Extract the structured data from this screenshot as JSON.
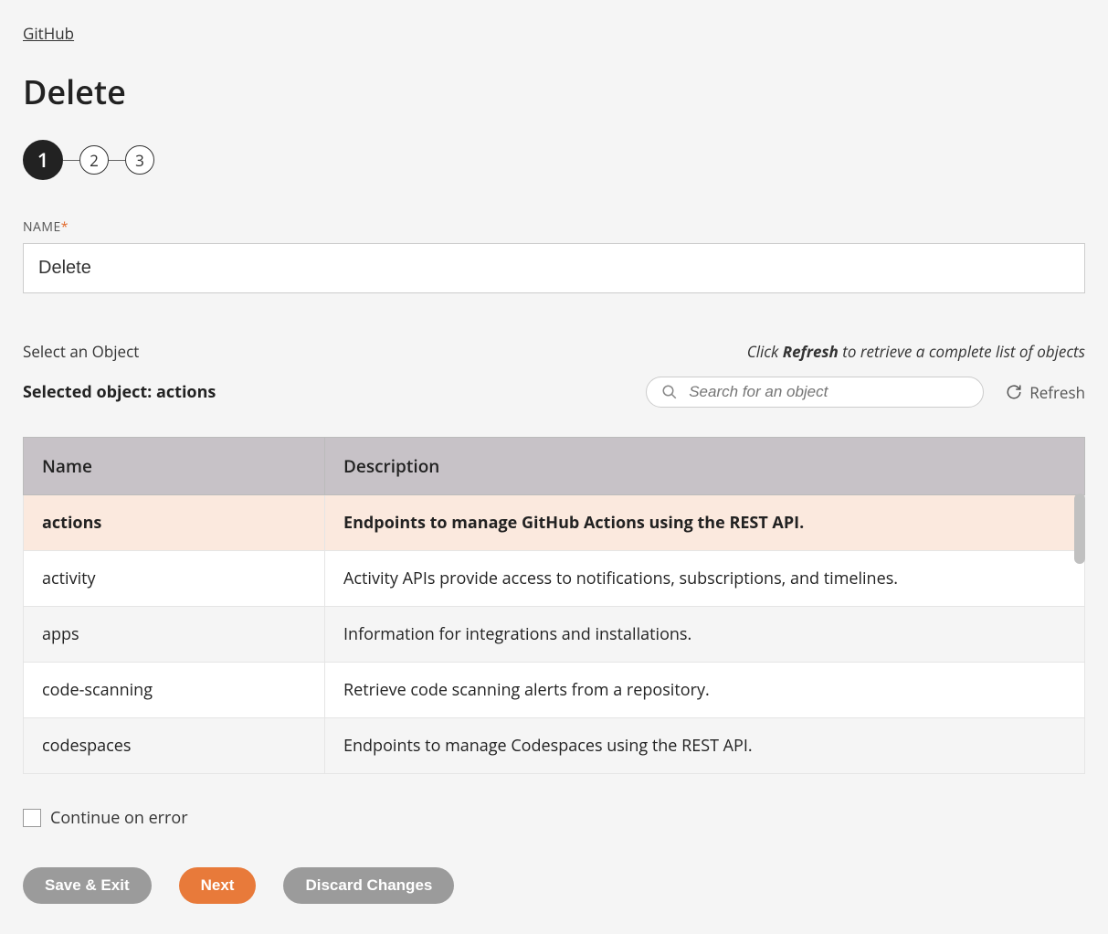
{
  "breadcrumb": {
    "parent": "GitHub"
  },
  "page": {
    "title": "Delete"
  },
  "stepper": {
    "steps": [
      "1",
      "2",
      "3"
    ],
    "active": 0
  },
  "form": {
    "name_label": "NAME",
    "required_mark": "*",
    "name_value": "Delete"
  },
  "object_section": {
    "select_label": "Select an Object",
    "hint_prefix": "Click ",
    "hint_bold": "Refresh",
    "hint_suffix": " to retrieve a complete list of objects",
    "selected_prefix": "Selected object: ",
    "selected_value": "actions",
    "search_placeholder": "Search for an object",
    "refresh_label": "Refresh"
  },
  "table": {
    "columns": {
      "name": "Name",
      "description": "Description"
    },
    "rows": [
      {
        "name": "actions",
        "description": "Endpoints to manage GitHub Actions using the REST API.",
        "selected": true
      },
      {
        "name": "activity",
        "description": "Activity APIs provide access to notifications, subscriptions, and timelines.",
        "selected": false
      },
      {
        "name": "apps",
        "description": "Information for integrations and installations.",
        "selected": false
      },
      {
        "name": "code-scanning",
        "description": "Retrieve code scanning alerts from a repository.",
        "selected": false
      },
      {
        "name": "codespaces",
        "description": "Endpoints to manage Codespaces using the REST API.",
        "selected": false
      }
    ]
  },
  "continue_on_error": {
    "label": "Continue on error",
    "checked": false
  },
  "buttons": {
    "save_exit": "Save & Exit",
    "next": "Next",
    "discard": "Discard Changes"
  }
}
